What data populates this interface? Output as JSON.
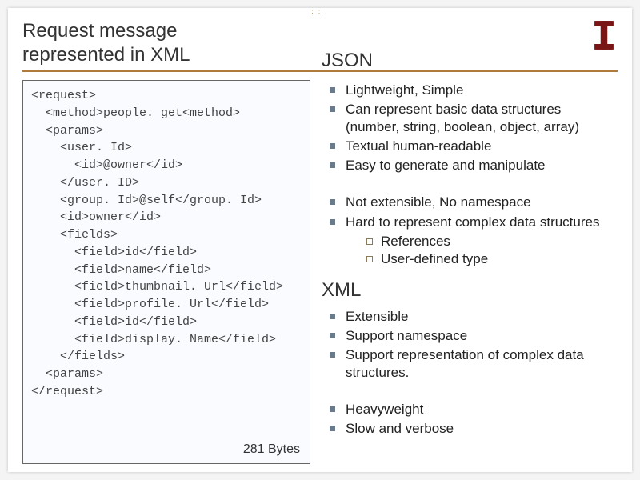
{
  "title": {
    "line1": "Request message",
    "line2": "represented in XML"
  },
  "code": {
    "lines": [
      "<request>",
      "  <method>people. get<method>",
      "  <params>",
      "    <user. Id>",
      "      <id>@owner</id>",
      "    </user. ID>",
      "    <group. Id>@self</group. Id>",
      "    <id>owner</id>",
      "    <fields>",
      "      <field>id</field>",
      "      <field>name</field>",
      "      <field>thumbnail. Url</field>",
      "      <field>profile. Url</field>",
      "      <field>id</field>",
      "      <field>display. Name</field>",
      "    </fields>",
      "  <params>",
      "</request>"
    ],
    "bytes": "281 Bytes"
  },
  "json_heading": "JSON",
  "json_pros": [
    "Lightweight, Simple",
    "Can represent basic data structures (number, string, boolean, object, array)",
    "Textual human-readable",
    "Easy to generate and manipulate"
  ],
  "json_cons": [
    "Not extensible, No namespace",
    {
      "text": "Hard to represent complex data structures",
      "sub": [
        "References",
        "User-defined type"
      ]
    }
  ],
  "xml_heading": "XML",
  "xml_pros": [
    "Extensible",
    "Support namespace",
    "Support representation of complex data structures."
  ],
  "xml_cons": [
    "Heavyweight",
    "Slow and verbose"
  ]
}
